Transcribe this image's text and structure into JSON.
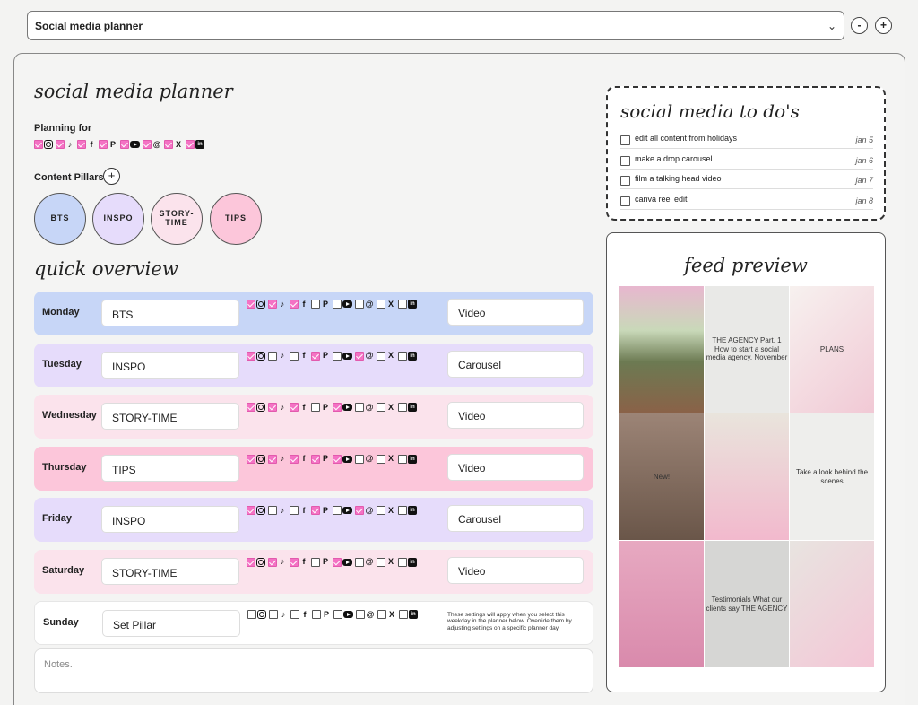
{
  "topbar": {
    "title": "Social media planner",
    "minus": "-",
    "plus": "+"
  },
  "planner": {
    "heading": "social media planner",
    "planning_for_label": "Planning for",
    "platforms": [
      {
        "icon": "instagram-icon",
        "glyph": "",
        "checked": true
      },
      {
        "icon": "tiktok-icon",
        "glyph": "♪",
        "checked": true
      },
      {
        "icon": "facebook-icon",
        "glyph": "f",
        "checked": true
      },
      {
        "icon": "pinterest-icon",
        "glyph": "P",
        "checked": true
      },
      {
        "icon": "youtube-icon",
        "glyph": "",
        "checked": true
      },
      {
        "icon": "threads-icon",
        "glyph": "@",
        "checked": true
      },
      {
        "icon": "x-icon",
        "glyph": "X",
        "checked": true
      },
      {
        "icon": "linkedin-icon",
        "glyph": "in",
        "checked": true
      }
    ],
    "content_pillars_label": "Content Pillars",
    "add_pillar": "+",
    "pillars": [
      {
        "label": "BTS",
        "color": "#c7d6f7"
      },
      {
        "label": "INSPO",
        "color": "#e6dcfb"
      },
      {
        "label": "STORY-\nTIME",
        "color": "#fbe3ec"
      },
      {
        "label": "TIPS",
        "color": "#fcc6da"
      }
    ]
  },
  "overview": {
    "heading": "quick overview",
    "days": [
      {
        "day": "Monday",
        "pillar": "BTS",
        "type": "Video",
        "bg": "#c7d6f7",
        "checks": [
          true,
          true,
          true,
          false,
          false,
          false,
          false,
          false
        ]
      },
      {
        "day": "Tuesday",
        "pillar": "INSPO",
        "type": "Carousel",
        "bg": "#e6dcfb",
        "checks": [
          true,
          false,
          false,
          true,
          false,
          true,
          false,
          false
        ]
      },
      {
        "day": "Wednesday",
        "pillar": "STORY-TIME",
        "type": "Video",
        "bg": "#fbe3ec",
        "checks": [
          true,
          true,
          true,
          false,
          true,
          false,
          false,
          false
        ]
      },
      {
        "day": "Thursday",
        "pillar": "TIPS",
        "type": "Video",
        "bg": "#fcc6da",
        "checks": [
          true,
          true,
          true,
          true,
          true,
          false,
          false,
          false
        ]
      },
      {
        "day": "Friday",
        "pillar": "INSPO",
        "type": "Carousel",
        "bg": "#e6dcfb",
        "checks": [
          true,
          false,
          false,
          true,
          false,
          true,
          false,
          false
        ]
      },
      {
        "day": "Saturday",
        "pillar": "STORY-TIME",
        "type": "Video",
        "bg": "#fbe3ec",
        "checks": [
          true,
          true,
          true,
          false,
          true,
          false,
          false,
          false
        ]
      },
      {
        "day": "Sunday",
        "pillar": "Set Pillar",
        "type": "",
        "bg": "#ffffff",
        "checks": [
          false,
          false,
          false,
          false,
          false,
          false,
          false,
          false
        ]
      }
    ],
    "sunday_note": "These settings will apply when you select this weekday in the planner below. Override them by adjusting settings on a specific planner day.",
    "notes_placeholder": "Notes."
  },
  "todos": {
    "heading": "social media to do's",
    "items": [
      {
        "text": "edit all content from holidays",
        "date": "jan 5"
      },
      {
        "text": "make a drop carousel",
        "date": "jan 6"
      },
      {
        "text": "film a talking head video",
        "date": "jan 7"
      },
      {
        "text": "canva reel edit",
        "date": "jan 8"
      }
    ]
  },
  "feed": {
    "heading": "feed preview",
    "tiles": [
      {
        "text": "",
        "bg": "linear-gradient(180deg,#e8b7cf 0%,#c9d9b9 35%,#6c7a52 60%,#8a6248 100%)"
      },
      {
        "text": "THE AGENCY  Part. 1  How to start a social media agency.  November",
        "bg": "#e9e9e7"
      },
      {
        "text": "PLANS",
        "bg": "linear-gradient(135deg,#f7f1ef,#f1c9d5)"
      },
      {
        "text": "New!",
        "bg": "linear-gradient(180deg,#9c8476,#6a5649)"
      },
      {
        "text": "",
        "bg": "linear-gradient(180deg,#e9e4dc,#f2b9cd)"
      },
      {
        "text": "Take a look behind the scenes",
        "bg": "#eeeeec"
      },
      {
        "text": "",
        "bg": "linear-gradient(180deg,#e7a9c1,#d98aac)"
      },
      {
        "text": "Testimonials  What our clients say  THE AGENCY",
        "bg": "#d6d6d4"
      },
      {
        "text": "",
        "bg": "linear-gradient(135deg,#e8e4e0,#f4c6d6)"
      }
    ]
  }
}
